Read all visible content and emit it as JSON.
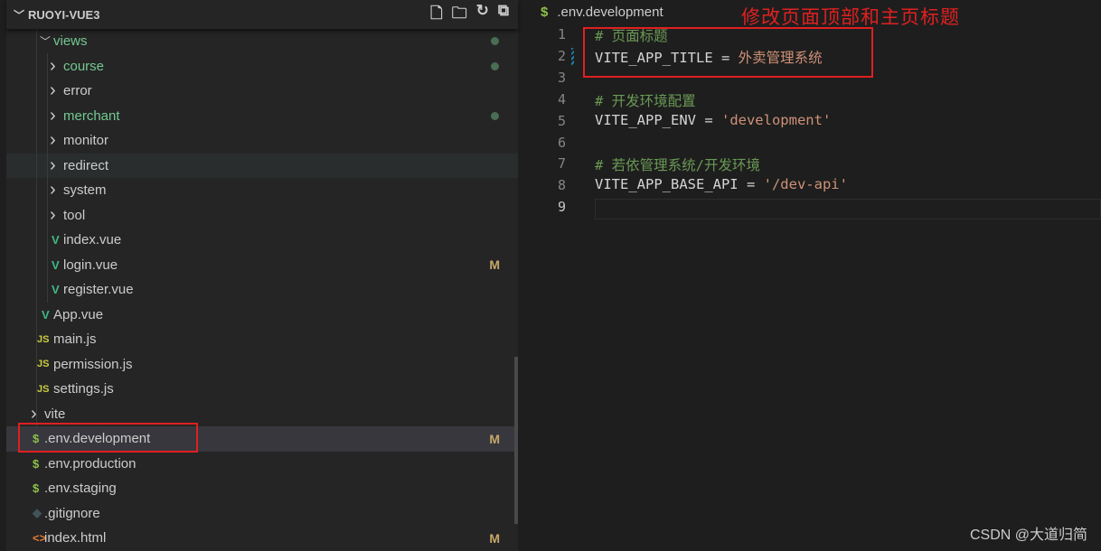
{
  "explorer": {
    "title": "RUOYI-VUE3",
    "actions": [
      "new-file-icon",
      "new-folder-icon",
      "refresh-icon",
      "collapse-all-icon"
    ],
    "items": [
      {
        "label": "views",
        "type": "folder-open",
        "level": 1,
        "color": "green",
        "dot": true
      },
      {
        "label": "course",
        "type": "folder",
        "level": 2,
        "color": "green",
        "dot": true
      },
      {
        "label": "error",
        "type": "folder",
        "level": 2
      },
      {
        "label": "merchant",
        "type": "folder",
        "level": 2,
        "color": "green",
        "dot": true
      },
      {
        "label": "monitor",
        "type": "folder",
        "level": 2
      },
      {
        "label": "redirect",
        "type": "folder",
        "level": 2,
        "hover": true
      },
      {
        "label": "system",
        "type": "folder",
        "level": 2
      },
      {
        "label": "tool",
        "type": "folder",
        "level": 2
      },
      {
        "label": "index.vue",
        "type": "vue",
        "level": 2
      },
      {
        "label": "login.vue",
        "type": "vue",
        "level": 2,
        "badge": "M"
      },
      {
        "label": "register.vue",
        "type": "vue",
        "level": 2
      },
      {
        "label": "App.vue",
        "type": "vue",
        "level": 1
      },
      {
        "label": "main.js",
        "type": "js",
        "level": 1
      },
      {
        "label": "permission.js",
        "type": "js",
        "level": 1
      },
      {
        "label": "settings.js",
        "type": "js",
        "level": 1
      },
      {
        "label": "vite",
        "type": "folder",
        "level": 0
      },
      {
        "label": ".env.development",
        "type": "env",
        "level": 0,
        "badge": "M",
        "selected": true
      },
      {
        "label": ".env.production",
        "type": "env",
        "level": 0
      },
      {
        "label": ".env.staging",
        "type": "env",
        "level": 0
      },
      {
        "label": ".gitignore",
        "type": "git",
        "level": 0
      },
      {
        "label": "index.html",
        "type": "html",
        "level": 0,
        "badge": "M"
      }
    ]
  },
  "editor": {
    "tab": ".env.development",
    "annotation": "修改页面顶部和主页标题",
    "lines": [
      {
        "n": "1",
        "comment": "# 页面标题"
      },
      {
        "n": "2",
        "key": "VITE_APP_TITLE",
        "op": " = ",
        "val": "外卖管理系统"
      },
      {
        "n": "3"
      },
      {
        "n": "4",
        "comment": "# 开发环境配置"
      },
      {
        "n": "5",
        "key": "VITE_APP_ENV",
        "op": " = ",
        "val": "'development'"
      },
      {
        "n": "6"
      },
      {
        "n": "7",
        "comment": "# 若依管理系统/开发环境"
      },
      {
        "n": "8",
        "key": "VITE_APP_BASE_API",
        "op": " = ",
        "val": "'/dev-api'"
      },
      {
        "n": "9"
      }
    ]
  },
  "watermark": "CSDN @大道归简"
}
